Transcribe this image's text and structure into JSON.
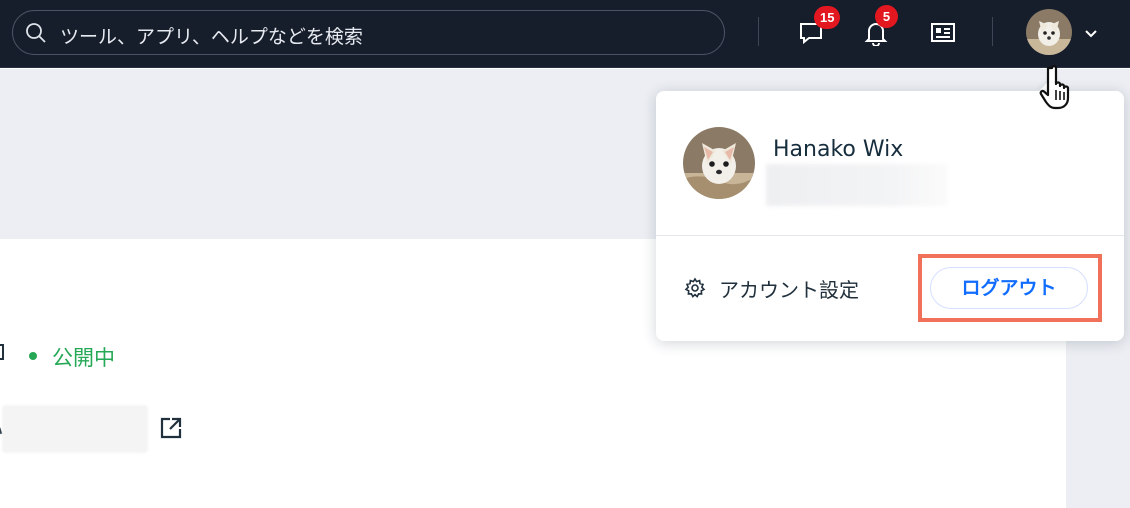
{
  "search": {
    "placeholder": "ツール、アプリ、ヘルプなどを検索"
  },
  "topbar": {
    "messages_badge": "15",
    "notifications_badge": "5"
  },
  "site": {
    "status": "公開中"
  },
  "account_menu": {
    "user_name": "Hanako Wix",
    "account_settings_label": "アカウント設定",
    "logout_label": "ログアウト"
  },
  "colors": {
    "topbar_bg": "#161d2b",
    "accent_blue": "#116dff",
    "status_green": "#25a855",
    "badge_red": "#e3171f",
    "highlight": "#f0705a"
  }
}
